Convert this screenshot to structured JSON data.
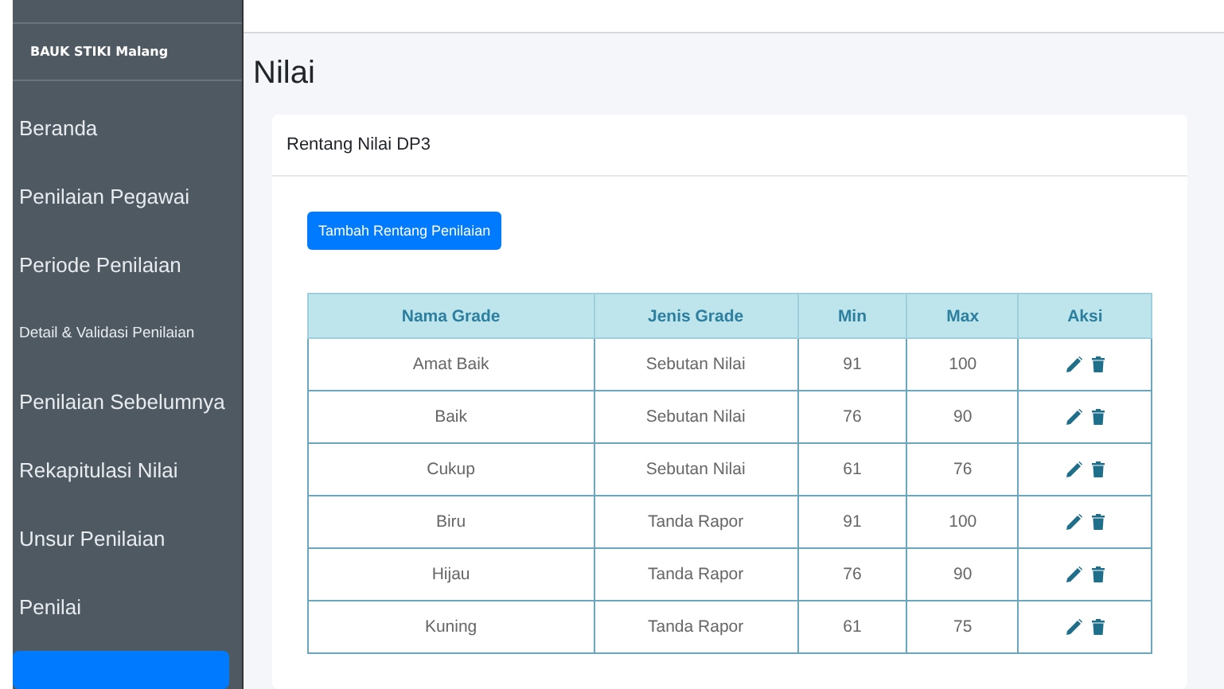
{
  "sidebar": {
    "brand": "BAUK STIKI Malang",
    "items": [
      {
        "label": "Beranda",
        "kind": "normal",
        "selected": false
      },
      {
        "label": "Penilaian Pegawai",
        "kind": "normal",
        "selected": false
      },
      {
        "label": "Periode Penilaian",
        "kind": "normal",
        "selected": false
      },
      {
        "label": "Detail & Validasi Penilaian",
        "kind": "compact",
        "selected": false
      },
      {
        "label": "Penilaian Sebelumnya",
        "kind": "normal",
        "selected": false
      },
      {
        "label": "Rekapitulasi Nilai",
        "kind": "normal",
        "selected": false
      },
      {
        "label": "Unsur Penilaian",
        "kind": "normal",
        "selected": false
      },
      {
        "label": "Penilai",
        "kind": "normal",
        "selected": false
      },
      {
        "kind": "normal",
        "selected": true
      }
    ]
  },
  "page_title": "Nilai",
  "card": {
    "title": "Rentang Nilai DP3",
    "add_button": "Tambah Rentang Penilaian",
    "table": {
      "columns": [
        "Nama Grade",
        "Jenis Grade",
        "Min",
        "Max",
        "Aksi"
      ],
      "rows": [
        [
          "Amat Baik",
          "Sebutan Nilai",
          "91",
          "100"
        ],
        [
          "Baik",
          "Sebutan Nilai",
          "76",
          "90"
        ],
        [
          "Cukup",
          "Sebutan Nilai",
          "61",
          "76"
        ],
        [
          "Biru",
          "Tanda Rapor",
          "91",
          "100"
        ],
        [
          "Hijau",
          "Tanda Rapor",
          "76",
          "90"
        ],
        [
          "Kuning",
          "Tanda Rapor",
          "61",
          "75"
        ]
      ]
    }
  }
}
